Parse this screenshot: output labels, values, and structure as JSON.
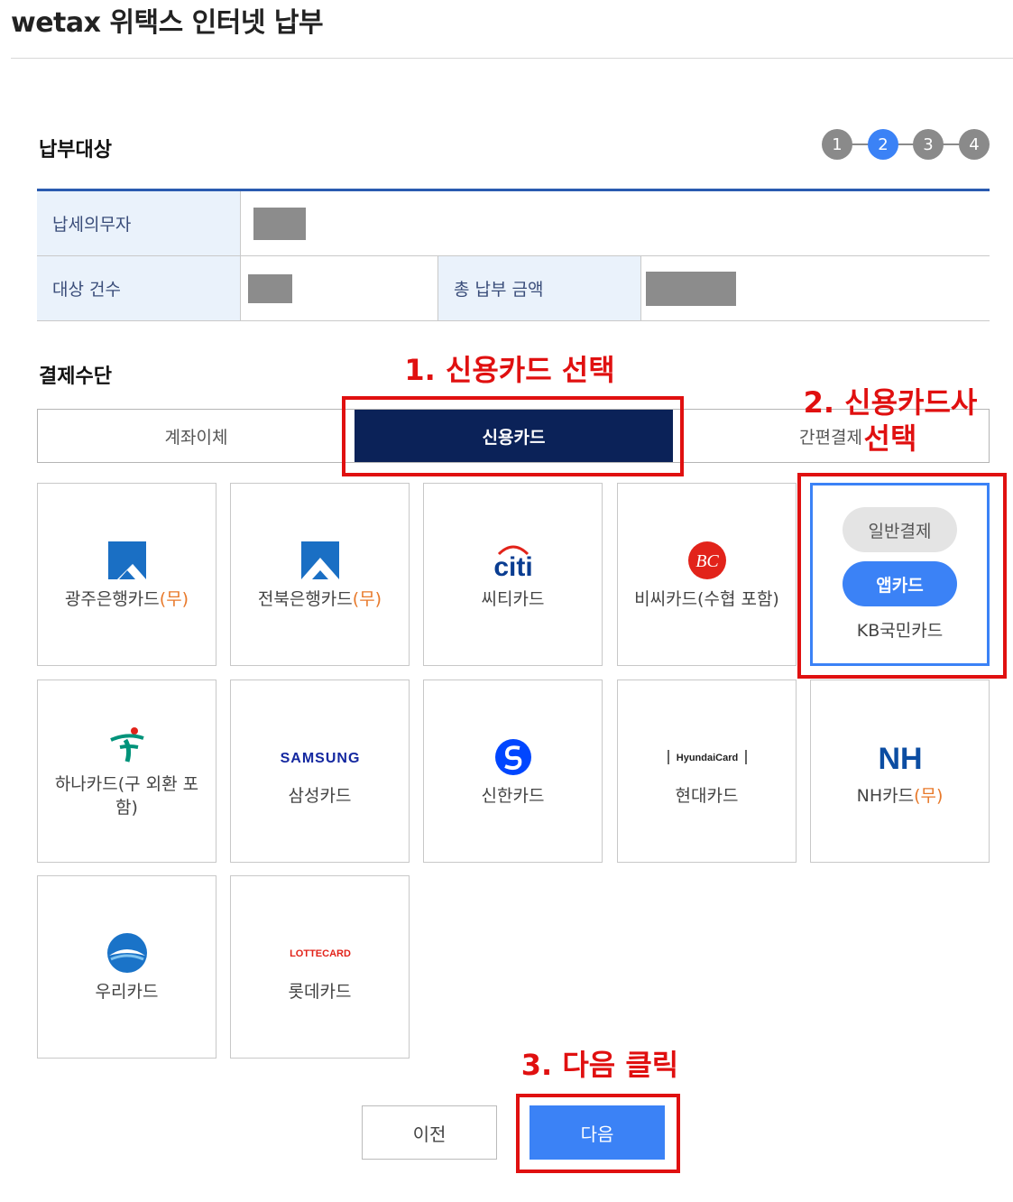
{
  "page": {
    "title": "wetax 위택스 인터넷 납부"
  },
  "target": {
    "section_title": "납부대상",
    "steps": [
      "1",
      "2",
      "3",
      "4"
    ],
    "active_step": 2,
    "rows": {
      "taxpayer_label": "납세의무자",
      "count_label": "대상 건수",
      "total_label": "총 납부 금액"
    }
  },
  "payment": {
    "section_title": "결제수단",
    "tabs": [
      "계좌이체",
      "신용카드",
      "간편결제"
    ],
    "selected_tab": "신용카드",
    "free_mark": "(무)",
    "cards": [
      {
        "name": "광주은행카드",
        "free": true,
        "logo": "gwangju-bank-logo"
      },
      {
        "name": "전북은행카드",
        "free": true,
        "logo": "jeonbuk-bank-logo"
      },
      {
        "name": "씨티카드",
        "free": false,
        "logo": "citi-logo"
      },
      {
        "name": "비씨카드(수협 포함)",
        "free": false,
        "logo": "bc-logo"
      },
      {
        "name": "하나카드(구 외환 포함)",
        "free": false,
        "logo": "hana-logo"
      },
      {
        "name": "삼성카드",
        "free": false,
        "logo": "samsung-logo"
      },
      {
        "name": "신한카드",
        "free": false,
        "logo": "shinhan-logo"
      },
      {
        "name": "현대카드",
        "free": false,
        "logo": "hyundai-card-logo"
      },
      {
        "name": "NH카드",
        "free": true,
        "logo": "nh-logo"
      },
      {
        "name": "우리카드",
        "free": false,
        "logo": "woori-logo"
      },
      {
        "name": "롯데카드",
        "free": false,
        "logo": "lotte-card-logo"
      }
    ],
    "kb_card": {
      "name": "KB국민카드",
      "normal_label": "일반결제",
      "app_label": "앱카드"
    },
    "logo_text": {
      "citi": "citi",
      "bc": "BC",
      "samsung": "SAMSUNG",
      "hyundai": "HyundaiCard",
      "nh": "NH",
      "lotte": "LOTTECARD"
    }
  },
  "buttons": {
    "prev_label": "이전",
    "next_label": "다음"
  },
  "annotations": {
    "step1": "1. 신용카드 선택",
    "step2": "2. 신용카드사 선택",
    "step3": "3. 다음 클릭"
  },
  "colors": {
    "accent": "#3b82f6",
    "navy": "#0b2258",
    "annotation": "#e01010",
    "free_mark": "#e8792a"
  }
}
